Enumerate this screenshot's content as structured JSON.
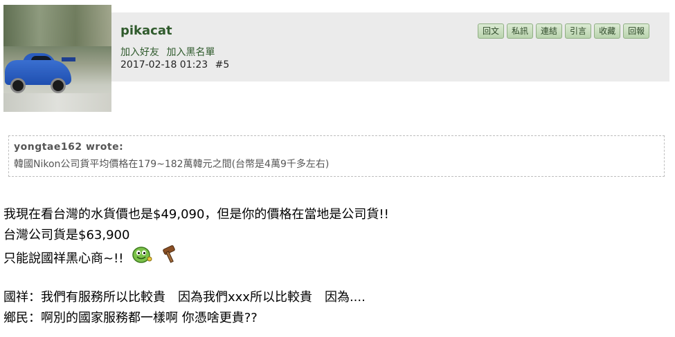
{
  "post": {
    "username": "pikacat",
    "add_friend": "加入好友",
    "add_blacklist": "加入黑名單",
    "timestamp": "2017-02-18 01:23",
    "post_number": "#5",
    "actions": [
      "回文",
      "私訊",
      "連結",
      "引言",
      "收藏",
      "回報"
    ]
  },
  "quote": {
    "author": "yongtae162 wrote:",
    "text": "韓國Nikon公司貨平均價格在179~182萬韓元之間(台幣是4萬9千多左右)"
  },
  "body": {
    "line1": "我現在看台灣的水貨價也是$49,090，但是你的價格在當地是公司貨!!",
    "line2": "台灣公司貨是$63,900",
    "line3": "只能說國祥黑心商~!!",
    "line4": "",
    "line5": "國祥：我們有服務所以比較貴　因為我們xxx所以比較貴　因為....",
    "line6": "鄉民：啊別的國家服務都一樣啊 你憑啥更貴??"
  },
  "icons": {
    "avatar": "rally-car-avatar",
    "emoji1": "green-smiley-emoji",
    "emoji2": "gavel-emoji"
  }
}
